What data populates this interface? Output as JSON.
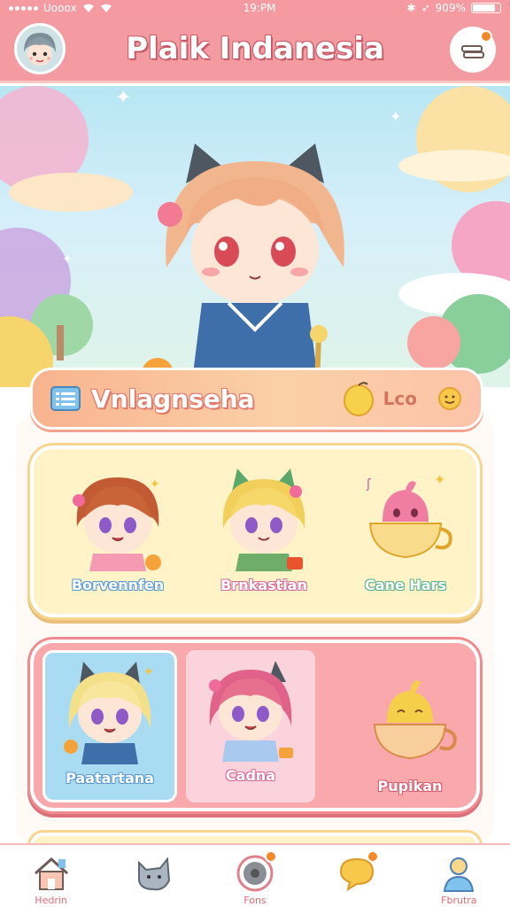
{
  "status_bar": {
    "carrier": "Uooox",
    "time": "19:PM",
    "battery": "909%"
  },
  "header": {
    "title": "Plaik Indanesia"
  },
  "section": {
    "title": "Vnlagnseha",
    "coin_label": "Lco"
  },
  "cards": [
    {
      "items": [
        {
          "label": "Borvennfen",
          "icon": "girl-brown-hair-character"
        },
        {
          "label": "Brnkastian",
          "icon": "girl-blonde-cat-ears-character"
        },
        {
          "label": "Cane Hars",
          "icon": "pink-slime-teacup-icon"
        }
      ]
    },
    {
      "items": [
        {
          "label": "Paatartana",
          "icon": "girl-blonde-cat-ears-character"
        },
        {
          "label": "Cadna",
          "icon": "girl-pink-hair-character"
        },
        {
          "label": "Pupikan",
          "icon": "yellow-slime-teacup-icon"
        }
      ]
    }
  ],
  "nav": [
    {
      "label": "Hedrin",
      "icon": "home-icon"
    },
    {
      "label": "",
      "icon": "cat-icon"
    },
    {
      "label": "Fons",
      "icon": "record-icon"
    },
    {
      "label": "",
      "icon": "chat-bubble-icon"
    },
    {
      "label": "Fbrutra",
      "icon": "profile-icon"
    }
  ],
  "colors": {
    "header": "#f49aa1",
    "accent_orange": "#f5892a",
    "card_yellow": "#fff3c7",
    "card_pink": "#f9a9ab"
  }
}
